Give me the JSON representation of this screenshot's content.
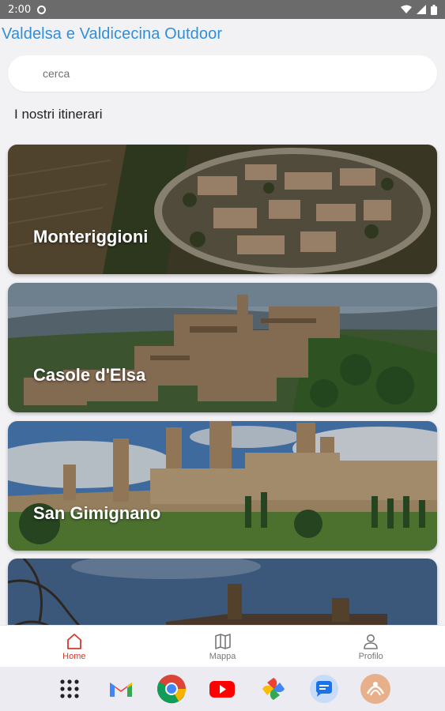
{
  "status": {
    "time": "2:00"
  },
  "app": {
    "title": "Valdelsa e Valdicecina Outdoor"
  },
  "search": {
    "placeholder": "cerca",
    "value": ""
  },
  "section": {
    "title": "I nostri itinerari"
  },
  "itineraries": [
    {
      "name": "Monteriggioni"
    },
    {
      "name": "Casole d'Elsa"
    },
    {
      "name": "San Gimignano"
    },
    {
      "name": ""
    }
  ],
  "nav": {
    "items": [
      {
        "label": "Home",
        "icon": "home-icon",
        "active": true
      },
      {
        "label": "Mappa",
        "icon": "map-icon",
        "active": false
      },
      {
        "label": "Profilo",
        "icon": "user-icon",
        "active": false
      }
    ]
  },
  "dock": {
    "apps": [
      "app-drawer-icon",
      "gmail-icon",
      "chrome-icon",
      "youtube-icon",
      "photos-icon",
      "messages-icon",
      "custom-app-icon"
    ]
  },
  "colors": {
    "title": "#2f8fd8",
    "active_nav": "#d23a2a"
  }
}
